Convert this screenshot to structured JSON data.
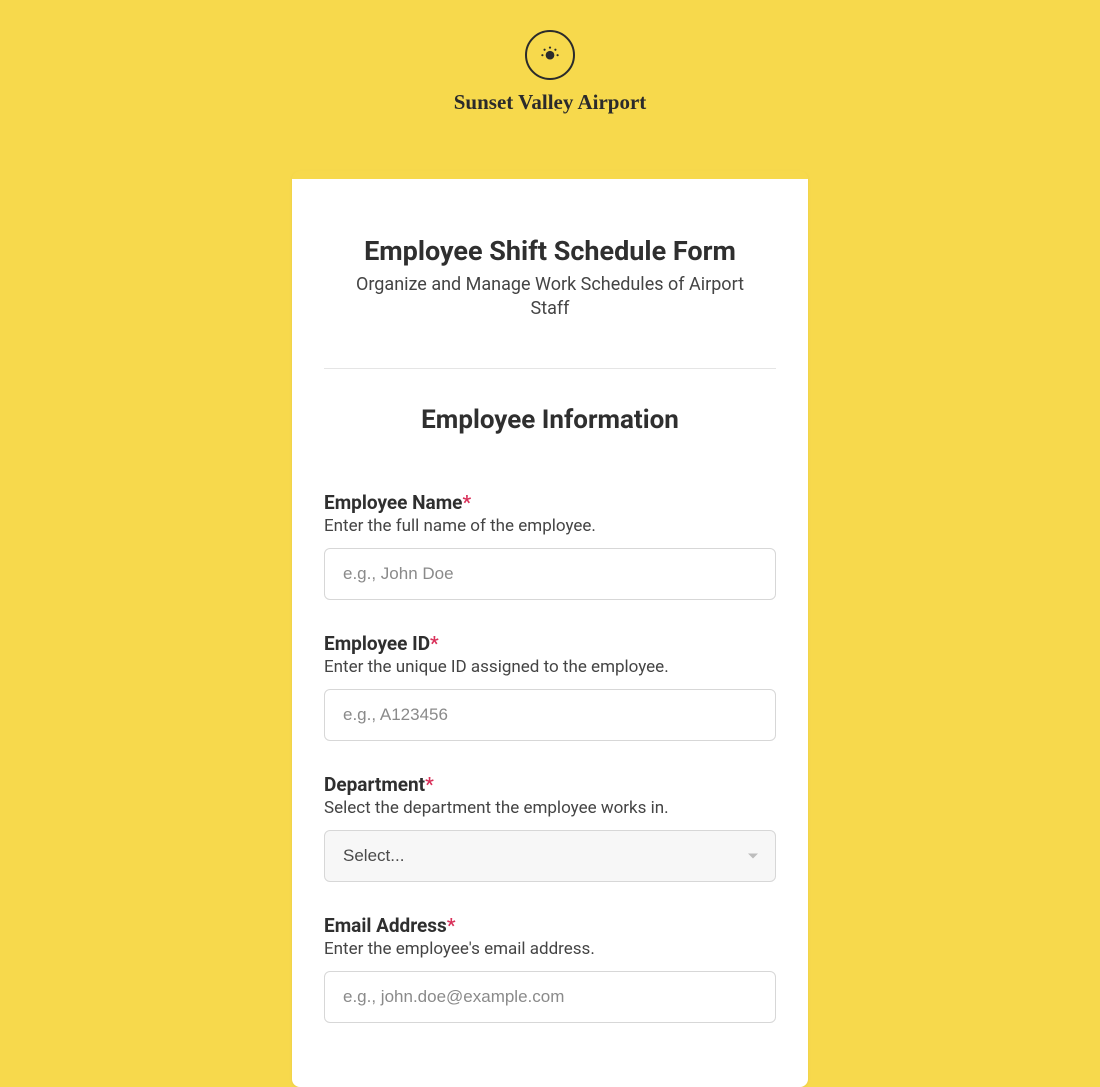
{
  "header": {
    "org_name": "Sunset Valley Airport",
    "icon_name": "sun-icon"
  },
  "form": {
    "title": "Employee Shift Schedule Form",
    "subtitle": "Organize and Manage Work Schedules of Airport Staff",
    "section_title": "Employee Information",
    "required_marker": "*",
    "fields": {
      "employee_name": {
        "label": "Employee Name",
        "help": "Enter the full name of the employee.",
        "placeholder": "e.g., John Doe",
        "value": "",
        "required": true
      },
      "employee_id": {
        "label": "Employee ID",
        "help": "Enter the unique ID assigned to the employee.",
        "placeholder": "e.g., A123456",
        "value": "",
        "required": true
      },
      "department": {
        "label": "Department",
        "help": "Select the department the employee works in.",
        "selected": "Select...",
        "required": true
      },
      "email": {
        "label": "Email Address",
        "help": "Enter the employee's email address.",
        "placeholder": "e.g., john.doe@example.com",
        "value": "",
        "required": true
      }
    }
  }
}
